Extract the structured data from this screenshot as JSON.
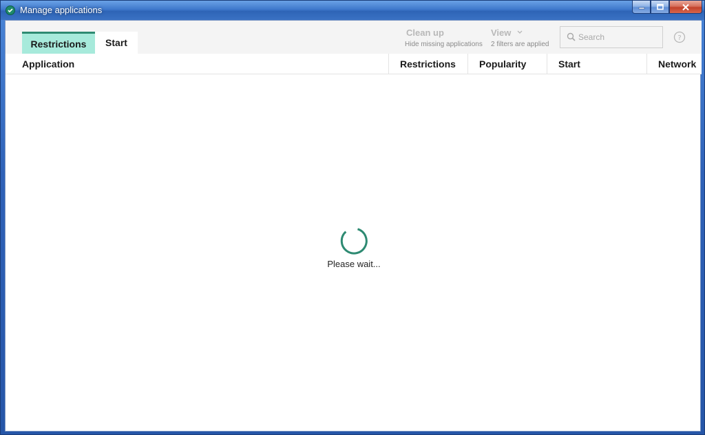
{
  "window": {
    "title": "Manage applications"
  },
  "tabs": [
    {
      "label": "Restrictions",
      "active": true
    },
    {
      "label": "Start",
      "active": false
    }
  ],
  "toolbar": {
    "cleanup": {
      "title": "Clean up",
      "subtitle": "Hide missing applications"
    },
    "view": {
      "title": "View",
      "subtitle": "2 filters are applied"
    },
    "search": {
      "placeholder": "Search"
    }
  },
  "columns": [
    "Application",
    "Restrictions",
    "Popularity",
    "Start",
    "Network"
  ],
  "loading": {
    "text": "Please wait..."
  },
  "colors": {
    "accent": "#2e8a72",
    "tab_active_bg": "#a7eadb",
    "titlebar": "#3f78cc"
  },
  "icons": [
    "shield-check-icon",
    "minimize-icon",
    "maximize-icon",
    "close-icon",
    "search-icon",
    "help-icon",
    "chevron-down-icon",
    "spinner-icon"
  ]
}
